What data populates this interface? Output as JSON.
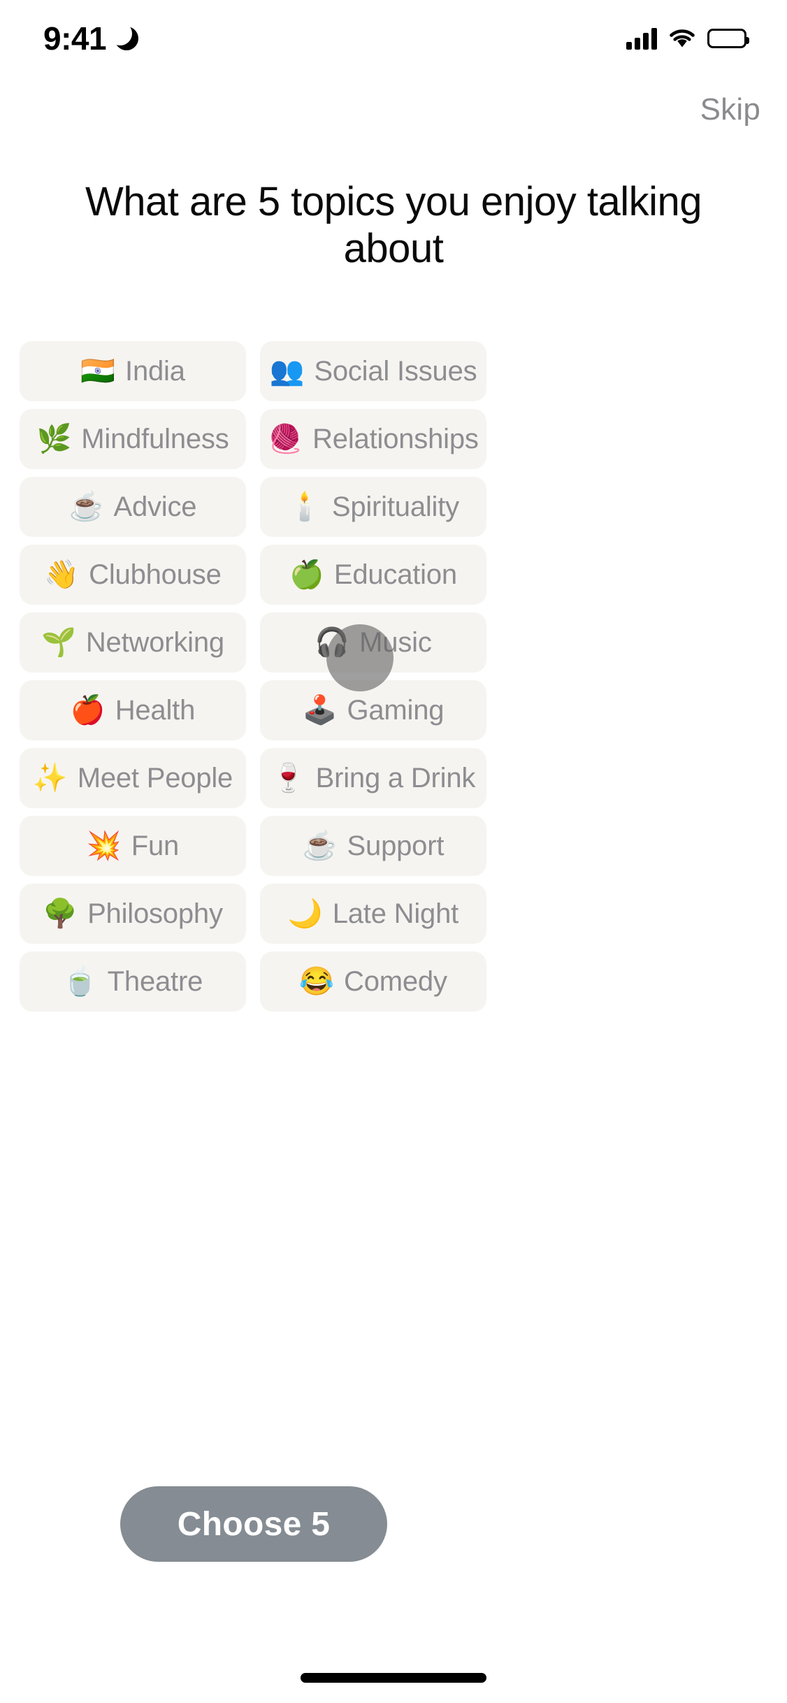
{
  "status_bar": {
    "time": "9:41",
    "dnd_icon": "crescent-moon-icon",
    "signal_icon": "cellular-signal-icon",
    "wifi_icon": "wifi-icon",
    "battery_icon": "battery-full-icon"
  },
  "header": {
    "skip_label": "Skip"
  },
  "main": {
    "title": "What are 5 topics you enjoy talking about",
    "topics": [
      {
        "emoji": "🇮🇳",
        "icon": "india-flag-icon",
        "label": "India",
        "column": "left"
      },
      {
        "emoji": "👥",
        "icon": "two-people-icon",
        "label": "Social Issues",
        "column": "right"
      },
      {
        "emoji": "🌿",
        "icon": "herb-leaf-icon",
        "label": "Mindfulness",
        "column": "left"
      },
      {
        "emoji": "🧶",
        "icon": "yarn-ball-icon",
        "label": "Relationships",
        "column": "right"
      },
      {
        "emoji": "☕",
        "icon": "hot-coffee-icon",
        "label": "Advice",
        "column": "left"
      },
      {
        "emoji": "🕯️",
        "icon": "candle-icon",
        "label": "Spirituality",
        "column": "right"
      },
      {
        "emoji": "👋",
        "icon": "waving-hand-icon",
        "label": "Clubhouse",
        "column": "left"
      },
      {
        "emoji": "🍏",
        "icon": "green-apple-icon",
        "label": "Education",
        "column": "right"
      },
      {
        "emoji": "🌱",
        "icon": "seedling-icon",
        "label": "Networking",
        "column": "left"
      },
      {
        "emoji": "🎧",
        "icon": "headphones-icon",
        "label": "Music",
        "column": "right"
      },
      {
        "emoji": "🍎",
        "icon": "red-apple-icon",
        "label": "Health",
        "column": "left"
      },
      {
        "emoji": "🕹️",
        "icon": "joystick-icon",
        "label": "Gaming",
        "column": "right"
      },
      {
        "emoji": "✨",
        "icon": "sparkles-icon",
        "label": "Meet People",
        "column": "left"
      },
      {
        "emoji": "🍷",
        "icon": "wine-glass-icon",
        "label": "Bring a Drink",
        "column": "right"
      },
      {
        "emoji": "💥",
        "icon": "collision-icon",
        "label": "Fun",
        "column": "left"
      },
      {
        "emoji": "☕",
        "icon": "hot-coffee-icon",
        "label": "Support",
        "column": "right"
      },
      {
        "emoji": "🌳",
        "icon": "tree-icon",
        "label": "Philosophy",
        "column": "left"
      },
      {
        "emoji": "🌙",
        "icon": "crescent-moon-icon",
        "label": "Late Night",
        "column": "right"
      },
      {
        "emoji": "🍵",
        "icon": "teacup-icon",
        "label": "Theatre",
        "column": "left"
      },
      {
        "emoji": "😂",
        "icon": "laughing-face-icon",
        "label": "Comedy",
        "column": "right"
      }
    ]
  },
  "footer": {
    "choose_button_label": "Choose 5"
  },
  "overlay": {
    "touch_indicator": "touch-point-indicator"
  },
  "colors": {
    "chip_background": "#f6f4f0",
    "chip_text": "#8d8d91",
    "title_text": "#0a0a0a",
    "skip_text": "#8b8b8e",
    "button_background": "#858c93",
    "button_text": "#ffffff",
    "page_background": "#ffffff"
  }
}
